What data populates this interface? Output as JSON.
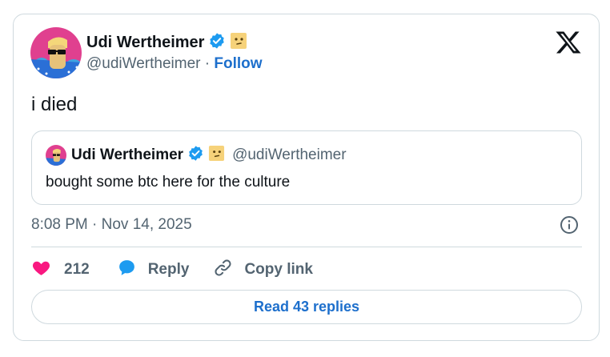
{
  "author": {
    "name": "Udi Wertheimer",
    "handle": "@udiWertheimer",
    "separator": "·",
    "follow_label": "Follow"
  },
  "tweet": {
    "text": "i died",
    "timestamp": "8:08 PM · Nov 14, 2025"
  },
  "quoted_tweet": {
    "name": "Udi Wertheimer",
    "handle": "@udiWertheimer",
    "text": "bought some btc here for the culture"
  },
  "actions": {
    "like_count": "212",
    "reply_label": "Reply",
    "copy_label": "Copy link"
  },
  "read_replies_label": "Read 43 replies",
  "colors": {
    "verified": "#1d9bf0",
    "like": "#f91880",
    "reply_icon": "#1d9bf0",
    "link": "#1d6fcc",
    "muted": "#536471",
    "border": "#cfd9de"
  },
  "icons": {
    "verified": "verified-badge-icon",
    "emoji": "face-emoji-icon",
    "brand": "x-logo-icon",
    "info": "info-icon",
    "like": "heart-icon",
    "reply": "speech-bubble-icon",
    "copy": "link-icon"
  }
}
